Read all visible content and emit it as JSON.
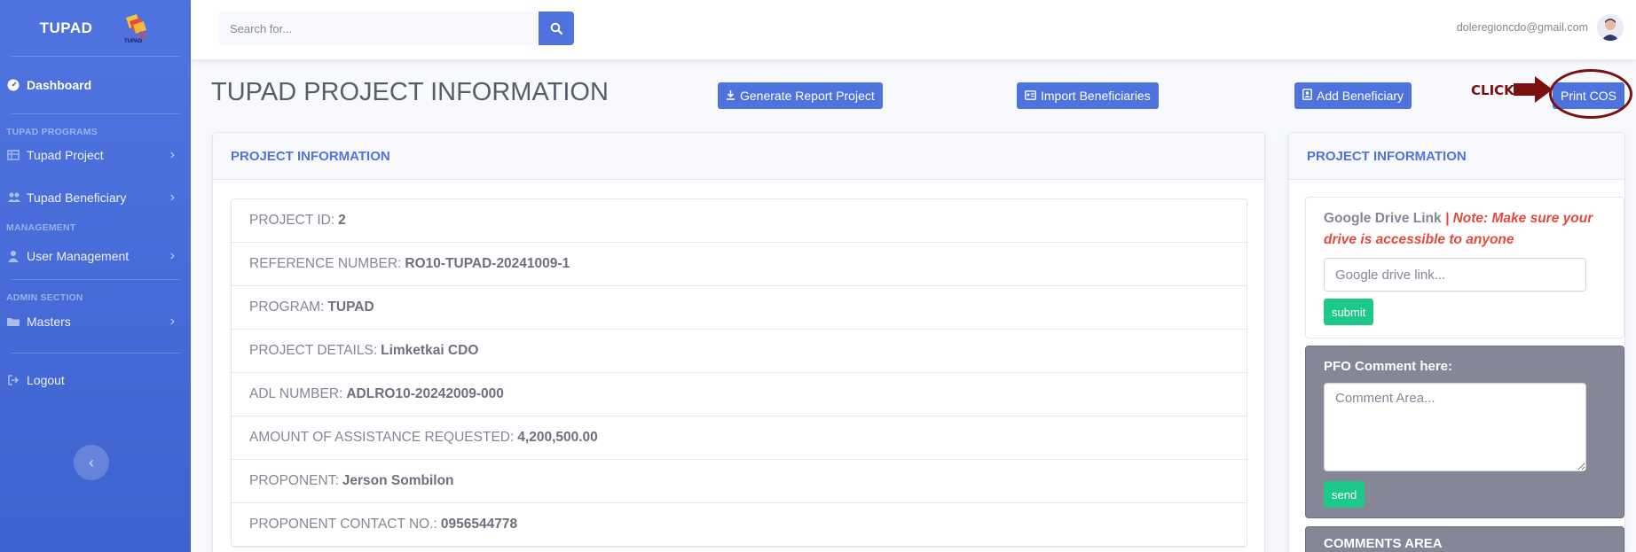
{
  "sidebar": {
    "brand": "TUPAD",
    "logo_text": "TUPAD",
    "dashboard": "Dashboard",
    "heading_programs": "TUPAD PROGRAMS",
    "tupad_project": "Tupad Project",
    "tupad_beneficiary": "Tupad Beneficiary",
    "heading_management": "MANAGEMENT",
    "user_management": "User Management",
    "heading_admin": "ADMIN SECTION",
    "masters": "Masters",
    "logout": "Logout"
  },
  "topbar": {
    "search_placeholder": "Search for...",
    "user_email": "doleregioncdo@gmail.com"
  },
  "header": {
    "title": "TUPAD PROJECT INFORMATION",
    "generate_report": "Generate Report Project",
    "import_beneficiaries": "Import Beneficiaries",
    "add_beneficiary": "Add Beneficiary",
    "annotation": "CLICK",
    "print_cos": "Print COS"
  },
  "project_card": {
    "title": "PROJECT INFORMATION",
    "rows": [
      {
        "label": "PROJECT ID:",
        "value": "2"
      },
      {
        "label": "REFERENCE NUMBER:",
        "value": "RO10-TUPAD-20241009-1"
      },
      {
        "label": "PROGRAM:",
        "value": "TUPAD"
      },
      {
        "label": "PROJECT DETAILS:",
        "value": "Limketkai CDO"
      },
      {
        "label": "ADL NUMBER:",
        "value": "ADLRO10-20242009-000"
      },
      {
        "label": "AMOUNT OF ASSISTANCE REQUESTED:",
        "value": "4,200,500.00"
      },
      {
        "label": "PROPONENT:",
        "value": "Jerson Sombilon"
      },
      {
        "label": "PROPONENT CONTACT NO.:",
        "value": "0956544778"
      }
    ]
  },
  "side_card": {
    "title": "PROJECT INFORMATION",
    "gdrive_label": "Google Drive Link",
    "gdrive_note": "| Note: Make sure your drive is accessible to anyone",
    "gdrive_placeholder": "Google drive link...",
    "submit": "submit",
    "pfo_title": "PFO Comment here:",
    "comment_placeholder": "Comment Area...",
    "send": "send",
    "comments_area": "COMMENTS AREA"
  },
  "colors": {
    "primary": "#4e73df",
    "success": "#1cc88a",
    "danger": "#e74a3b",
    "annotation": "#7b1010"
  }
}
